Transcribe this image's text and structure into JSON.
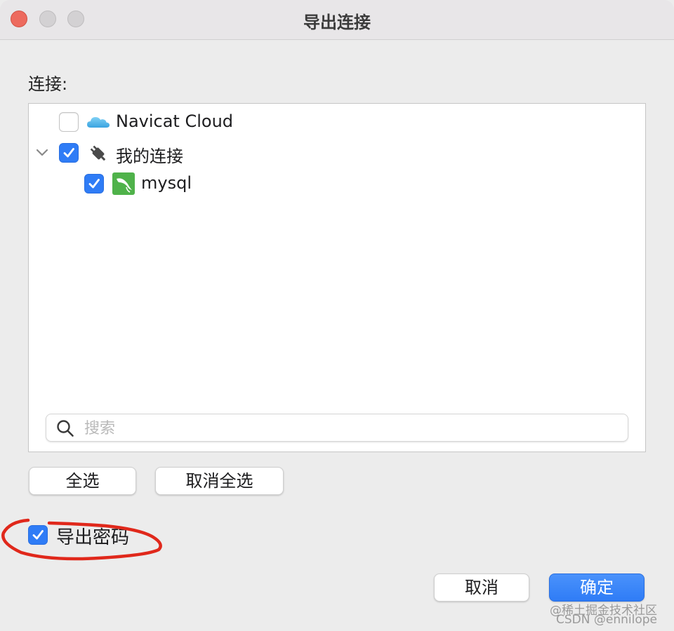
{
  "window": {
    "title": "导出连接"
  },
  "connections_label": "连接:",
  "tree": {
    "items": [
      {
        "label": "Navicat Cloud",
        "checked": false,
        "icon": "cloud-icon"
      },
      {
        "label": "我的连接",
        "checked": true,
        "icon": "plug-icon",
        "expanded": true
      },
      {
        "label": "mysql",
        "checked": true,
        "icon": "mysql-dolphin-icon"
      }
    ]
  },
  "search": {
    "placeholder": "搜索",
    "value": ""
  },
  "buttons": {
    "select_all": "全选",
    "deselect_all": "取消全选",
    "cancel": "取消",
    "ok": "确定"
  },
  "export_password": {
    "label": "导出密码",
    "checked": true
  },
  "watermark": {
    "line1": "@稀土掘金技术社区",
    "line2": "CSDN @ennilope"
  },
  "colors": {
    "accent": "#2f7cf6",
    "annotation": "#e0281b",
    "close": "#ed6a5e"
  }
}
